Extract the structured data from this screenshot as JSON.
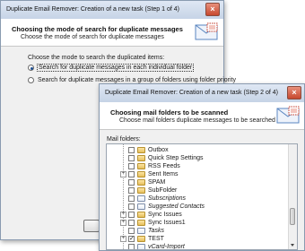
{
  "window1": {
    "title": "Duplicate Email Remover: Creation of a new task (Step 1 of 4)",
    "close_glyph": "×",
    "header_title": "Choosing the mode of search for duplicate messages",
    "header_subtitle": "Choose the mode of search for duplicate messages",
    "prompt": "Choose the mode to search the duplicated items:",
    "options": [
      {
        "label": "Search for duplicate messages in each individual folder",
        "selected": true
      },
      {
        "label": "Search for duplicate messages in a group of folders using folder priority",
        "selected": false
      }
    ]
  },
  "window2": {
    "title": "Duplicate Email Remover: Creation of a new task (Step 2 of 4)",
    "close_glyph": "×",
    "header_title": "Choosing mail folders to be scanned",
    "header_subtitle": "Choose mail folders duplicate messages to be searched for in",
    "folders_label": "Mail folders:",
    "folders": [
      {
        "label": "Outbox",
        "expander": false,
        "checked": false,
        "italic": false,
        "special": false
      },
      {
        "label": "Quick Step Settings",
        "expander": false,
        "checked": false,
        "italic": false,
        "special": false
      },
      {
        "label": "RSS Feeds",
        "expander": false,
        "checked": false,
        "italic": false,
        "special": false
      },
      {
        "label": "Sent Items",
        "expander": true,
        "checked": false,
        "italic": false,
        "special": false
      },
      {
        "label": "SPAM",
        "expander": false,
        "checked": false,
        "italic": false,
        "special": false
      },
      {
        "label": "SubFolder",
        "expander": false,
        "checked": false,
        "italic": false,
        "special": false
      },
      {
        "label": "Subscriptions",
        "expander": false,
        "checked": false,
        "italic": true,
        "special": true
      },
      {
        "label": "Suggested Contacts",
        "expander": false,
        "checked": false,
        "italic": true,
        "special": true
      },
      {
        "label": "Sync Issues",
        "expander": true,
        "checked": false,
        "italic": false,
        "special": false
      },
      {
        "label": "Sync Issues1",
        "expander": true,
        "checked": false,
        "italic": false,
        "special": false
      },
      {
        "label": "Tasks",
        "expander": false,
        "checked": false,
        "italic": true,
        "special": true
      },
      {
        "label": "TEST",
        "expander": true,
        "checked": true,
        "italic": false,
        "special": false
      },
      {
        "label": "vCard-Import",
        "expander": false,
        "checked": false,
        "italic": true,
        "special": true
      }
    ]
  },
  "icons": {
    "close": "close-icon",
    "header": "email-stamp-icon",
    "expander": "plus-expander-icon",
    "folder": "folder-icon",
    "checkbox": "checkbox-icon"
  },
  "colors": {
    "titlebar": "#c6d4e6",
    "close": "#c7482e",
    "stamp": "#c23a2a",
    "envelope": "#5a86c0"
  }
}
